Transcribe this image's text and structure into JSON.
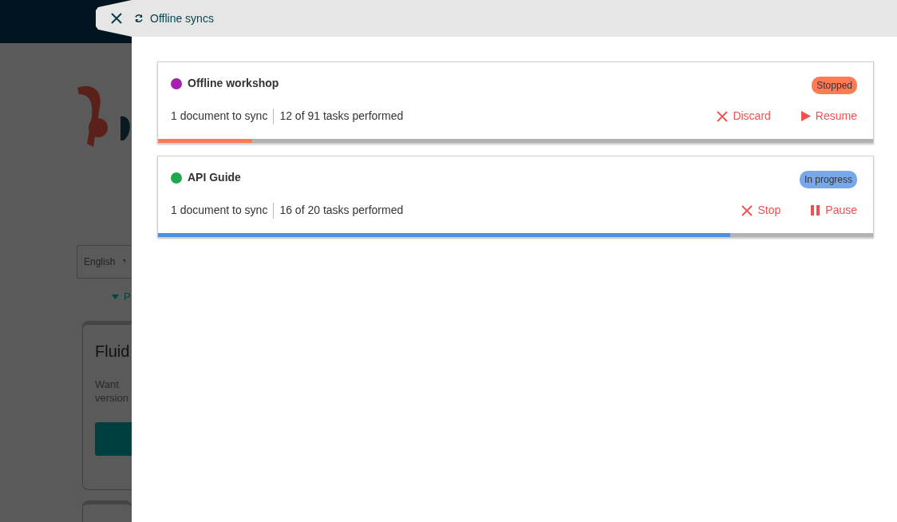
{
  "background": {
    "language_select": "English",
    "link": "P",
    "card": {
      "title": "Fluid",
      "text_lines": [
        "Want",
        "version"
      ]
    }
  },
  "panel": {
    "title": "Offline syncs",
    "syncs": [
      {
        "name": "Offline workshop",
        "color": "#a321ad",
        "status": "Stopped",
        "kind": "stopped",
        "documents": "1 document to sync",
        "tasks": "12 of 91 tasks performed",
        "level": 0.132,
        "actions": [
          {
            "kind": "cancel",
            "label": "Discard"
          },
          {
            "kind": "play",
            "label": "Resume"
          }
        ]
      },
      {
        "name": "API Guide",
        "color": "#1fa84f",
        "status": "In progress",
        "kind": "in_progress",
        "documents": "1 document to sync",
        "tasks": "16 of 20 tasks performed",
        "level": 0.8,
        "actions": [
          {
            "kind": "cancel",
            "label": "Stop"
          },
          {
            "kind": "pause",
            "label": "Pause"
          }
        ]
      }
    ]
  }
}
